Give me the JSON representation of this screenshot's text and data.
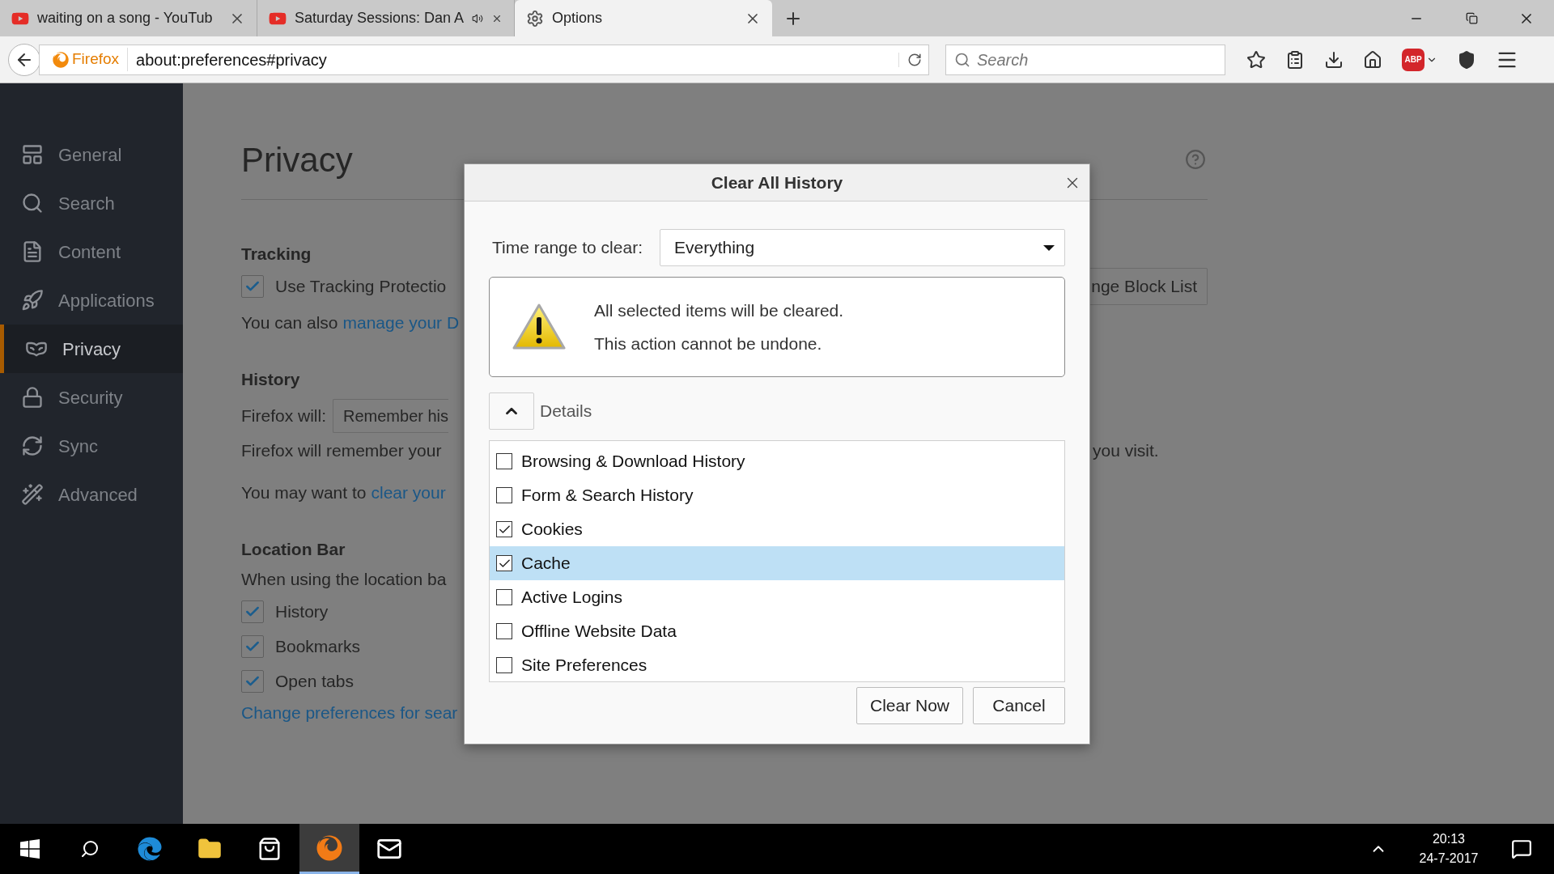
{
  "browser": {
    "tabs": [
      {
        "title": "waiting on a song - YouTub",
        "kind": "video",
        "selected": false,
        "audio": false
      },
      {
        "title": "Saturday Sessions: Dan A",
        "kind": "video",
        "selected": false,
        "audio": true
      },
      {
        "title": "Options",
        "kind": "settings",
        "selected": true,
        "audio": false
      }
    ],
    "identity": "Firefox",
    "url": "about:preferences#privacy",
    "search_placeholder": "Search",
    "adblock_label": "ABP"
  },
  "sidebar": {
    "items": [
      {
        "label": "General",
        "selected": false
      },
      {
        "label": "Search",
        "selected": false
      },
      {
        "label": "Content",
        "selected": false
      },
      {
        "label": "Applications",
        "selected": false
      },
      {
        "label": "Privacy",
        "selected": true
      },
      {
        "label": "Security",
        "selected": false
      },
      {
        "label": "Sync",
        "selected": false
      },
      {
        "label": "Advanced",
        "selected": false
      }
    ]
  },
  "page": {
    "title": "Privacy",
    "tracking": {
      "heading": "Tracking",
      "checkbox_label": "Use Tracking Protectio",
      "checked": true,
      "also_text": "You can also",
      "also_link": "manage your D",
      "block_list_button": "nge Block List"
    },
    "history": {
      "heading": "History",
      "will_label": "Firefox will:",
      "will_value": "Remember his",
      "remember_text": "Firefox will remember your",
      "remember_text_end": "you visit.",
      "may_text": "You may want to",
      "may_link": "clear your"
    },
    "location_bar": {
      "heading": "Location Bar",
      "intro": "When using the location ba",
      "options": [
        {
          "label": "History",
          "checked": true
        },
        {
          "label": "Bookmarks",
          "checked": true
        },
        {
          "label": "Open tabs",
          "checked": true
        }
      ],
      "change_link": "Change preferences for sear"
    }
  },
  "dialog": {
    "title": "Clear All History",
    "time_range_label": "Time range to clear:",
    "time_range_value": "Everything",
    "warning_lines": [
      "All selected items will be cleared.",
      "This action cannot be undone."
    ],
    "details_label": "Details",
    "details_expanded": true,
    "items": [
      {
        "label": "Browsing & Download History",
        "checked": false,
        "selected": false
      },
      {
        "label": "Form & Search History",
        "checked": false,
        "selected": false
      },
      {
        "label": "Cookies",
        "checked": true,
        "selected": false
      },
      {
        "label": "Cache",
        "checked": true,
        "selected": true
      },
      {
        "label": "Active Logins",
        "checked": false,
        "selected": false
      },
      {
        "label": "Offline Website Data",
        "checked": false,
        "selected": false
      },
      {
        "label": "Site Preferences",
        "checked": false,
        "selected": false
      }
    ],
    "buttons": [
      "Clear Now",
      "Cancel"
    ]
  },
  "taskbar": {
    "time": "20:13",
    "date": "24-7-2017"
  }
}
